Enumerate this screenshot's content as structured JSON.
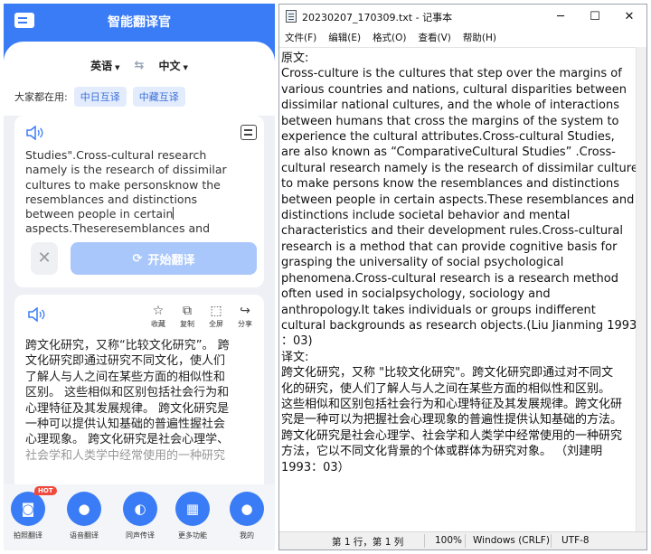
{
  "app": {
    "title": "智能翻译官",
    "source_lang": "英语",
    "target_lang": "中文",
    "popular_label": "大家都在用:",
    "popular_chips": [
      "中日互译",
      "中藏互译"
    ],
    "input_lines": [
      "Studies\".Cross-cultural research",
      "namely is the research of dissimilar",
      "cultures to make personsknow the",
      "resemblances and distinctions",
      "between people in certain",
      "aspects.Theseresemblances and"
    ],
    "translate_button": "开始翻译",
    "tools": [
      "收藏",
      "复制",
      "全屏",
      "分享"
    ],
    "output_lines": [
      "跨文化研究，又称“比较文化研究”。 跨",
      "文化研究即通过研究不同文化，使人们",
      "了解人与人之间在某些方面的相似性和",
      "区别。 这些相似和区别包括社会行为和",
      "心理特征及其发展规律。 跨文化研究是",
      "一种可以提供认知基础的普遍性握社会",
      "心理现象。 跨文化研究是社会心理学、",
      "社会学和人类学中经常使用的一种研究"
    ],
    "nav": [
      {
        "label": "拍照翻译",
        "badge": "HOT"
      },
      {
        "label": "语音翻译"
      },
      {
        "label": "同声传译"
      },
      {
        "label": "更多功能"
      },
      {
        "label": "我的"
      }
    ],
    "accent": "#3a7cf6"
  },
  "notepad": {
    "title": "20230207_170309.txt - 记事本",
    "menu": [
      "文件(F)",
      "编辑(E)",
      "格式(O)",
      "查看(V)",
      "帮助(H)"
    ],
    "lines": [
      "原文:",
      "Cross-culture is the cultures that step over the margins of",
      "various countries and nations,  cultural disparities between",
      "dissimilar national cultures,  and the whole of interactions",
      "between humans that cross the margins of the system to",
      "experience the cultural attributes.Cross-cultural Studies,",
      "are also known as “ComparativeCultural Studies” .Cross-",
      "cultural research namely is the research of dissimilar cultures",
      "to make persons know the resemblances and distinctions",
      "between people in certain aspects.These resemblances and",
      "distinctions include societal behavior and mental",
      "characteristics and their development rules.Cross-cultural",
      "research is a method that can provide cognitive basis for",
      "grasping the universality of social psychological",
      "phenomena.Cross-cultural research is a research method",
      "often used in socialpsychology,  sociology and",
      "anthropology.It takes individuals or groups indifferent",
      "cultural backgrounds as research objects.(Liu Jianming 1993",
      "：03)",
      "译文:",
      "跨文化研究，又称 \"比较文化研究\"。跨文化研究即通过对不同文",
      "化的研究，使人们了解人与人之间在某些方面的相似性和区别。",
      "这些相似和区别包括社会行为和心理特征及其发展规律。跨文化研",
      "究是一种可以为把握社会心理现象的普遍性提供认知基础的方法。",
      "跨文化研究是社会心理学、社会学和人类学中经常使用的一种研究",
      "方法，它以不同文化背景的个体或群体为研究对象。 （刘建明",
      "1993：03）"
    ],
    "status": {
      "position": "第 1 行，第 1 列",
      "zoom": "100%",
      "line_ending": "Windows (CRLF)",
      "encoding": "UTF-8"
    },
    "window_buttons": {
      "minimize": "─",
      "maximize": "☐",
      "close": "✕"
    }
  }
}
